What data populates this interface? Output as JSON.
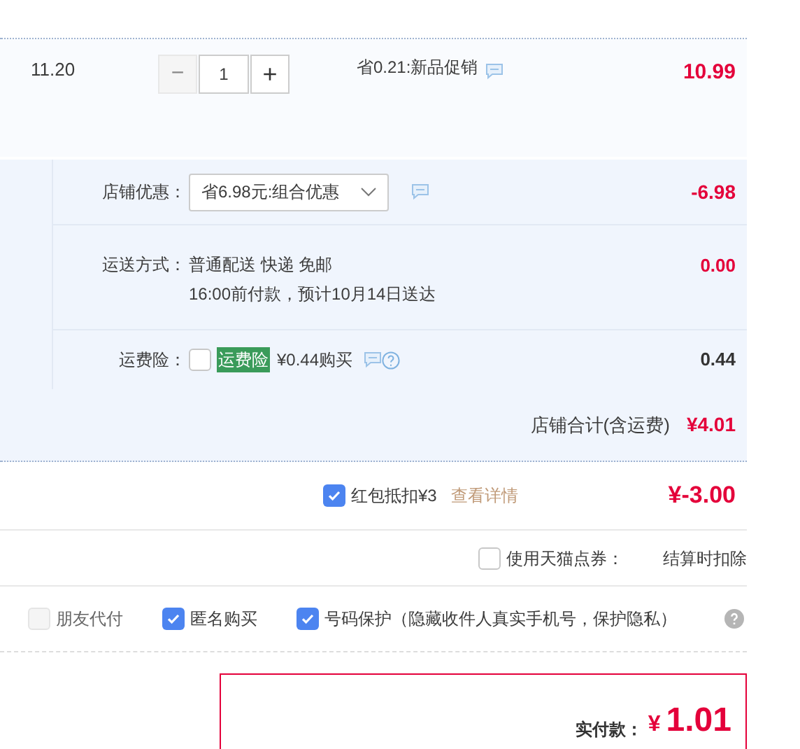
{
  "item": {
    "price": "11.20",
    "decrease": "−",
    "quantity": "1",
    "increase": "+",
    "decrease_disabled": true,
    "promo": "省0.21:新品促销",
    "subtotal": "10.99"
  },
  "shop": {
    "discount": {
      "label": "店铺优惠：",
      "select": "省6.98元:组合优惠",
      "amount": "-6.98"
    },
    "shipping": {
      "label": "运送方式：",
      "line1": "普通配送 快递 免邮",
      "line2": "16:00前付款，预计10月14日送达",
      "amount": "0.00"
    },
    "insurance": {
      "label": "运费险：",
      "checked": false,
      "tag": "运费险",
      "offer": "¥0.44购买",
      "amount": "0.44"
    },
    "total_label": "店铺合计(含运费)",
    "total": "¥4.01"
  },
  "red_packet": {
    "checked": true,
    "label": "红包抵扣¥3",
    "link": "查看详情",
    "amount": "¥-3.00"
  },
  "coupon": {
    "checked": false,
    "label": "使用天猫点券：",
    "note": "结算时扣除"
  },
  "options": [
    {
      "label": "朋友代付",
      "checked": false,
      "disabled": true
    },
    {
      "label": "匿名购买",
      "checked": true,
      "disabled": false
    },
    {
      "label": "号码保护（隐藏收件人真实手机号，保护隐私）",
      "checked": true,
      "disabled": false
    }
  ],
  "payment": {
    "label": "实付款：",
    "currency": "¥",
    "amount": "1.01"
  }
}
